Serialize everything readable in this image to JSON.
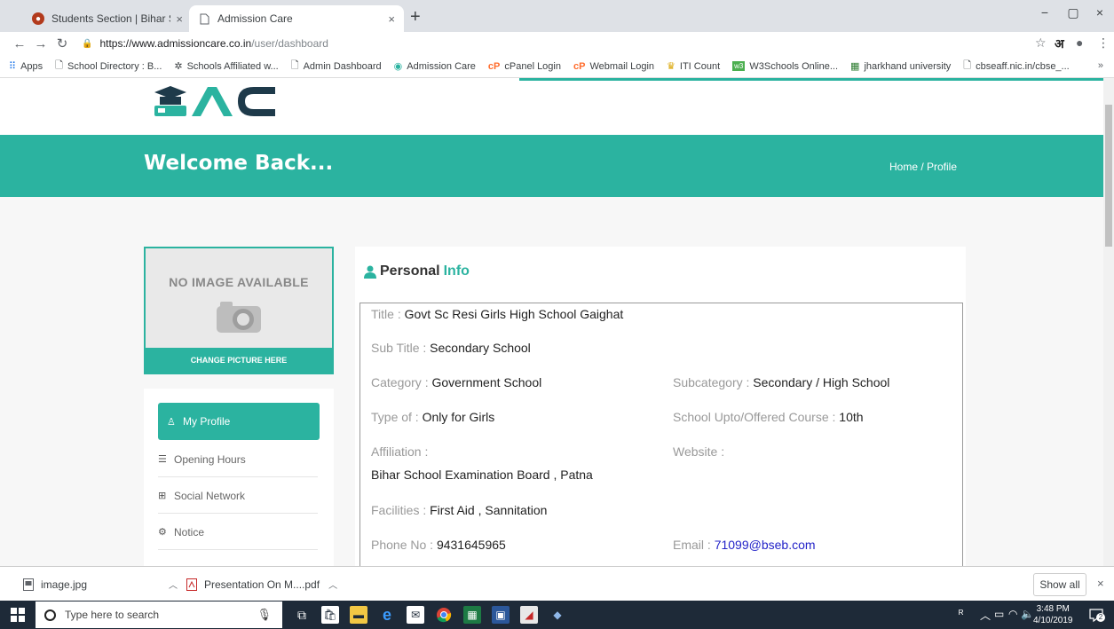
{
  "browser": {
    "tabs": [
      {
        "label": "Students Section | Bihar School E",
        "close": "×"
      },
      {
        "label": "Admission Care",
        "close": "×"
      }
    ],
    "new_tab": "+",
    "window_controls": {
      "minimize": "−",
      "maximize": "▢",
      "close": "×"
    },
    "url_host": "https://www.admissioncare.co.in",
    "url_path": "/user/dashboard",
    "language_button": "अ",
    "bookmarks": [
      {
        "label": "Apps",
        "icon": "apps-grid-icon"
      },
      {
        "label": "School Directory : B...",
        "icon": "page-icon"
      },
      {
        "label": "Schools Affiliated w...",
        "icon": "school-icon"
      },
      {
        "label": "Admin Dashboard",
        "icon": "page-icon"
      },
      {
        "label": "Admission Care",
        "icon": "location-pin-icon"
      },
      {
        "label": "cPanel Login",
        "icon": "cpanel-icon"
      },
      {
        "label": "Webmail Login",
        "icon": "cpanel-icon"
      },
      {
        "label": "ITI Count",
        "icon": "trophy-icon"
      },
      {
        "label": "W3Schools Online...",
        "icon": "w3schools-icon"
      },
      {
        "label": "jharkhand university",
        "icon": "building-icon"
      },
      {
        "label": "cbseaff.nic.in/cbse_...",
        "icon": "page-icon"
      }
    ],
    "bookmarks_more": "»"
  },
  "page": {
    "hero_title": "Welcome Back...",
    "breadcrumb": "Home / Profile",
    "picture": {
      "no_image_text": "NO IMAGE AVAILABLE",
      "change_button": "CHANGE PICTURE HERE"
    },
    "menu": {
      "active": "My Profile",
      "items": [
        "Opening Hours",
        "Social Network",
        "Notice"
      ]
    },
    "info": {
      "heading_main": "Personal",
      "heading_accent": "Info",
      "title_label": "Title :",
      "title_value": "Govt Sc Resi Girls High School Gaighat",
      "subtitle_label": "Sub Title :",
      "subtitle_value": "Secondary School",
      "category_label": "Category :",
      "category_value": "Government School",
      "subcategory_label": "Subcategory :",
      "subcategory_value": "Secondary / High School",
      "type_label": "Type of :",
      "type_value": "Only for Girls",
      "upto_label": "School Upto/Offered Course :",
      "upto_value": "10th",
      "affiliation_label": "Affiliation :",
      "affiliation_value": "Bihar School Examination Board , Patna",
      "website_label": "Website :",
      "facilities_label": "Facilities :",
      "facilities_value": "First Aid , Sannitation",
      "phone_label": "Phone No :",
      "phone_value": "9431645965",
      "email_label": "Email :",
      "email_value": "71099@bseb.com"
    }
  },
  "downloads": {
    "items": [
      "image.jpg",
      "Presentation On M....pdf"
    ],
    "show_all": "Show all",
    "close": "×"
  },
  "taskbar": {
    "search_placeholder": "Type here to search",
    "time": "3:48 PM",
    "date": "4/10/2019",
    "notification_count": "2"
  },
  "colors": {
    "accent": "#2bb3a0",
    "link": "#2323c8"
  }
}
